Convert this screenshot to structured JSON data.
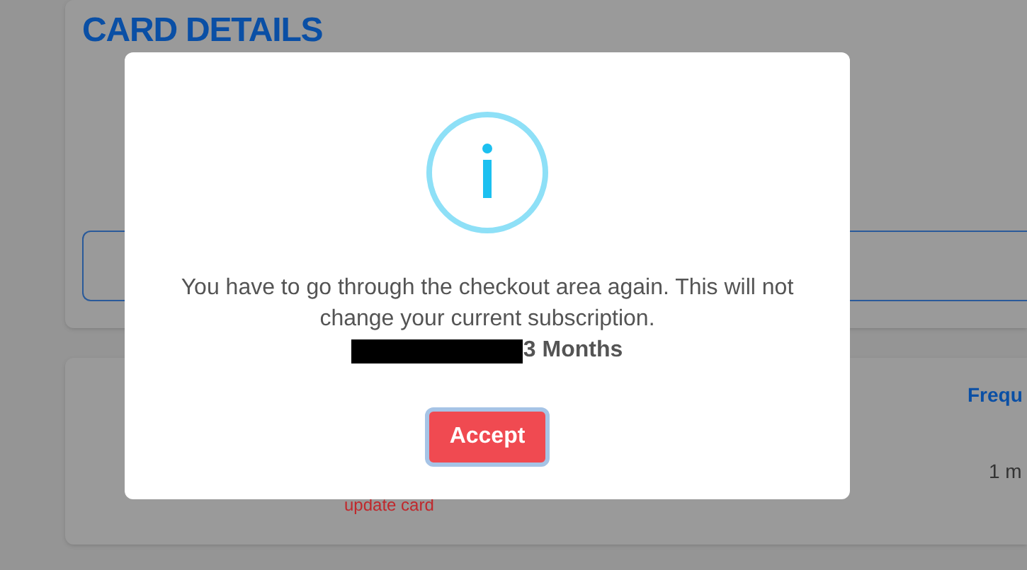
{
  "page": {
    "heading": "CARD DETAILS",
    "table": {
      "column_header": "Frequ",
      "cell": "1 m"
    },
    "update_link": "update card"
  },
  "dialog": {
    "message": "You have to go through the checkout area again. This will not change your current subscription.",
    "plan_suffix": "3 Months",
    "button": "Accept"
  }
}
